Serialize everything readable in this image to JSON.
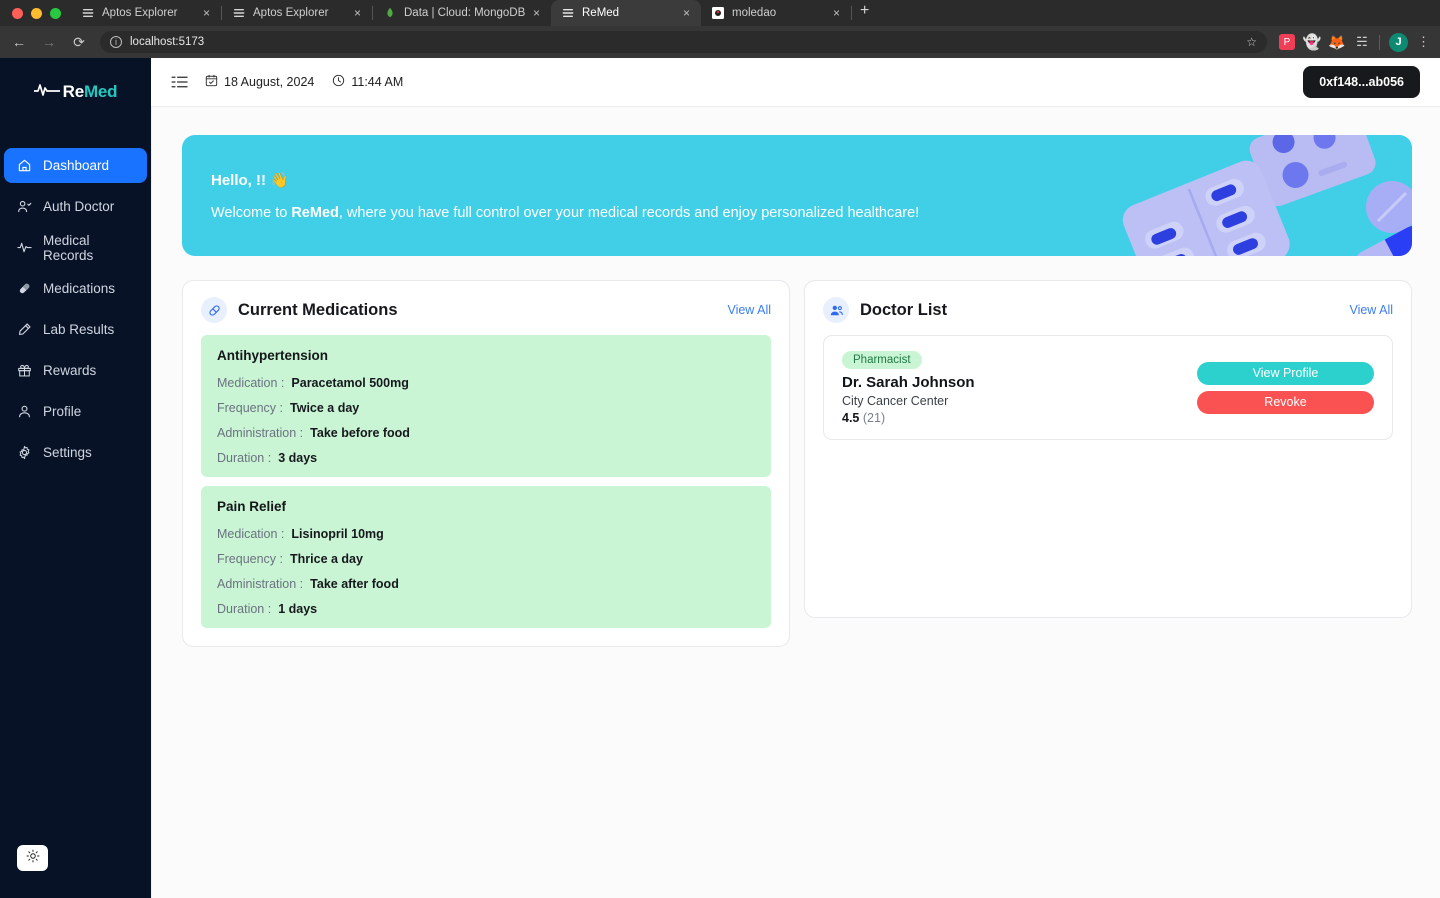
{
  "browser": {
    "tabs": [
      {
        "title": "Aptos Explorer",
        "favicon": "aptos-icon",
        "active": false
      },
      {
        "title": "Aptos Explorer",
        "favicon": "aptos-icon",
        "active": false
      },
      {
        "title": "Data | Cloud: MongoDB Cloud",
        "favicon": "mongodb-icon",
        "active": false
      },
      {
        "title": "ReMed",
        "favicon": "aptos-icon",
        "active": true
      },
      {
        "title": "moledao",
        "favicon": "moledao-icon",
        "active": false
      }
    ],
    "new_tab_label": "+",
    "close_label": "×",
    "nav": {
      "back": "←",
      "forward": "→",
      "reload": "⟳"
    },
    "url": "localhost:5173",
    "bookmark_icon": "star-icon",
    "extensions": [
      "pocket-extension-icon",
      "ghost-extension-icon",
      "fox-extension-icon",
      "plug-extension-icon"
    ],
    "profile_initial": "J",
    "menu_icon": "kebab-menu-icon"
  },
  "sidebar": {
    "logo": {
      "pulse_icon": "heartbeat-icon",
      "part1": "Re",
      "part2": "Med"
    },
    "items": [
      {
        "label": "Dashboard",
        "icon": "home-icon",
        "active": true
      },
      {
        "label": "Auth Doctor",
        "icon": "user-check-icon",
        "active": false
      },
      {
        "label": "Medical Records",
        "icon": "activity-icon",
        "active": false
      },
      {
        "label": "Medications",
        "icon": "pill-icon",
        "active": false
      },
      {
        "label": "Lab Results",
        "icon": "flask-icon",
        "active": false
      },
      {
        "label": "Rewards",
        "icon": "gift-icon",
        "active": false
      },
      {
        "label": "Profile",
        "icon": "user-icon",
        "active": false
      },
      {
        "label": "Settings",
        "icon": "gear-icon",
        "active": false
      }
    ],
    "theme_toggle_icon": "sun-icon"
  },
  "topbar": {
    "menu_icon": "sidebar-collapse-icon",
    "calendar_icon": "calendar-icon",
    "date": "18 August, 2024",
    "clock_icon": "clock-icon",
    "time": "11:44 AM",
    "wallet": "0xf148...ab056"
  },
  "banner": {
    "greeting": "Hello, !! 👋",
    "welcome_prefix": "Welcome to ",
    "brand": "ReMed",
    "welcome_suffix": ", where you have full control over your medical records and enjoy personalized healthcare!",
    "art": "pill-blister-pack-illustration",
    "bg_color": "#41cfe8"
  },
  "medications_card": {
    "icon": "pill-icon",
    "title": "Current Medications",
    "view_all": "View All",
    "labels": {
      "medication": "Medication :",
      "frequency": "Frequency :",
      "administration": "Administration :",
      "duration": "Duration :"
    },
    "items": [
      {
        "name": "Antihypertension",
        "medication": "Paracetamol 500mg",
        "frequency": "Twice a day",
        "administration": "Take before food",
        "duration": "3 days"
      },
      {
        "name": "Pain Relief",
        "medication": "Lisinopril 10mg",
        "frequency": "Thrice a day",
        "administration": "Take after food",
        "duration": "1 days"
      }
    ]
  },
  "doctors_card": {
    "icon": "users-icon",
    "title": "Doctor List",
    "view_all": "View All",
    "items": [
      {
        "badge": "Pharmacist",
        "name": "Dr. Sarah Johnson",
        "org": "City Cancer Center",
        "rating": "4.5",
        "rating_count": "(21)",
        "primary_button": "View Profile",
        "danger_button": "Revoke"
      }
    ]
  },
  "colors": {
    "accent_blue": "#1a73ff",
    "link_blue": "#3b7ef0",
    "banner_cyan": "#41cfe8",
    "med_green": "#c9f5d5",
    "teal_button": "#2cd0cc",
    "red_button": "#fa5252",
    "sidebar_navy": "#081226"
  }
}
